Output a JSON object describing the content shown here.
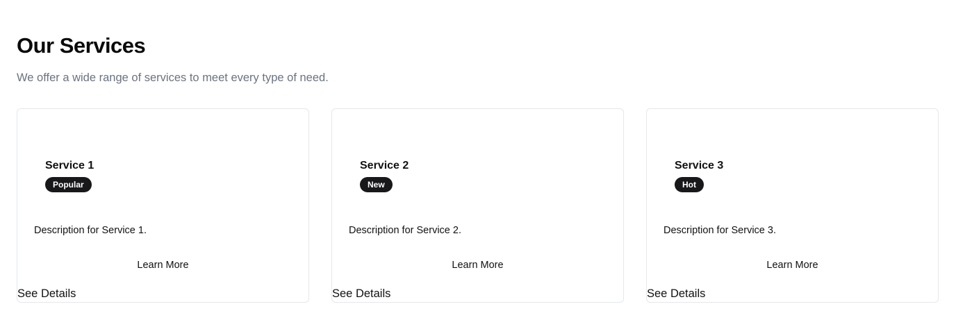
{
  "header": {
    "title": "Our Services",
    "subtitle": "We offer a wide range of services to meet every type of need."
  },
  "cards": [
    {
      "title": "Service 1",
      "badge": "Popular",
      "description": "Description for Service 1.",
      "primary_action": "Learn More",
      "secondary_action": "See Details"
    },
    {
      "title": "Service 2",
      "badge": "New",
      "description": "Description for Service 2.",
      "primary_action": "Learn More",
      "secondary_action": "See Details"
    },
    {
      "title": "Service 3",
      "badge": "Hot",
      "description": "Description for Service 3.",
      "primary_action": "Learn More",
      "secondary_action": "See Details"
    }
  ],
  "colors": {
    "badge_background": "#18181b",
    "subtitle_text": "#6b7280",
    "card_border": "#e5e7eb"
  }
}
